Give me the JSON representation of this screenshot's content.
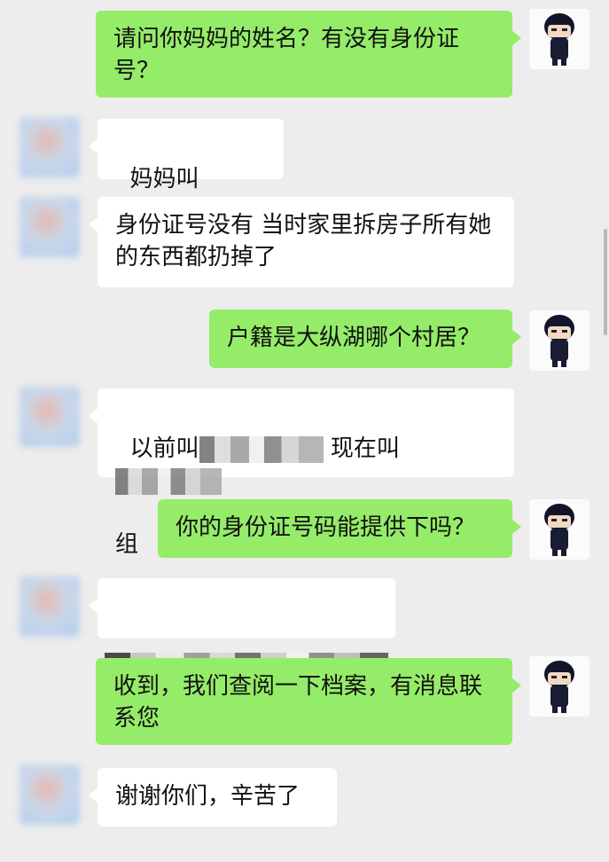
{
  "messages": [
    {
      "dir": "out",
      "text": "请问你妈妈的姓名？有没有身份证号？"
    },
    {
      "dir": "in",
      "prefix": "妈妈叫",
      "redacted": true
    },
    {
      "dir": "in",
      "text": "身份证号没有 当时家里拆房子所有她的东西都扔掉了"
    },
    {
      "dir": "out",
      "text": "户籍是大纵湖哪个村居？"
    },
    {
      "dir": "in",
      "part1": "以前叫",
      "part2": "现在叫",
      "part3": "组",
      "redacted": true
    },
    {
      "dir": "out",
      "text": "你的身份证号码能提供下吗？"
    },
    {
      "dir": "in",
      "redacted_full": true
    },
    {
      "dir": "out",
      "text": "收到，我们查阅一下档案，有消息联系您"
    },
    {
      "dir": "in",
      "text": "谢谢你们，辛苦了"
    }
  ],
  "colors": {
    "outgoing_bubble": "#95ec69",
    "incoming_bubble": "#ffffff",
    "background": "#ededed"
  },
  "icons": {
    "sender_avatar": "police-cartoon-avatar-icon",
    "receiver_avatar": "blurred-user-avatar-icon"
  }
}
